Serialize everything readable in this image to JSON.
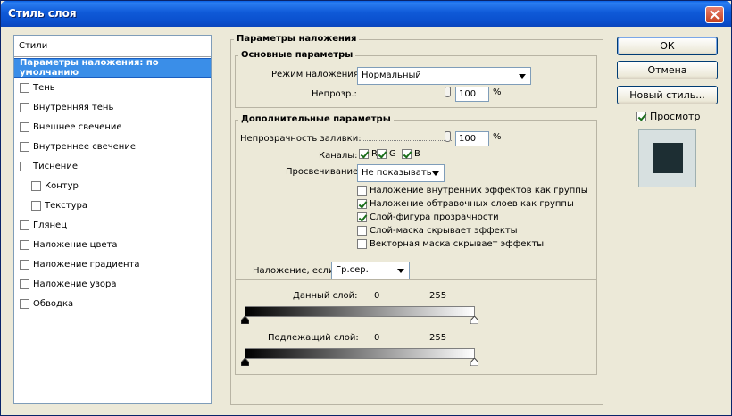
{
  "window": {
    "title": "Стиль слоя"
  },
  "style_list": {
    "header": "Стили",
    "items": [
      {
        "label": "Параметры наложения: по умолчанию",
        "checkbox": false,
        "checked": false,
        "selected": true,
        "indent": false
      },
      {
        "label": "Тень",
        "checkbox": true,
        "checked": false,
        "indent": false
      },
      {
        "label": "Внутренняя тень",
        "checkbox": true,
        "checked": false,
        "indent": false
      },
      {
        "label": "Внешнее свечение",
        "checkbox": true,
        "checked": false,
        "indent": false
      },
      {
        "label": "Внутреннее свечение",
        "checkbox": true,
        "checked": false,
        "indent": false
      },
      {
        "label": "Тиснение",
        "checkbox": true,
        "checked": false,
        "indent": false
      },
      {
        "label": "Контур",
        "checkbox": true,
        "checked": false,
        "indent": true
      },
      {
        "label": "Текстура",
        "checkbox": true,
        "checked": false,
        "indent": true
      },
      {
        "label": "Глянец",
        "checkbox": true,
        "checked": false,
        "indent": false
      },
      {
        "label": "Наложение цвета",
        "checkbox": true,
        "checked": false,
        "indent": false
      },
      {
        "label": "Наложение градиента",
        "checkbox": true,
        "checked": false,
        "indent": false
      },
      {
        "label": "Наложение узора",
        "checkbox": true,
        "checked": false,
        "indent": false
      },
      {
        "label": "Обводка",
        "checkbox": true,
        "checked": false,
        "indent": false
      }
    ]
  },
  "blending": {
    "title": "Параметры наложения",
    "basic": {
      "title": "Основные параметры",
      "mode_label": "Режим наложения:",
      "mode_value": "Нормальный",
      "opacity_label": "Непрозр.:",
      "opacity_value": "100",
      "opacity_unit": "%",
      "opacity_level": 1.0
    },
    "advanced": {
      "title": "Дополнительные параметры",
      "fill_label": "Непрозрачность заливки:",
      "fill_value": "100",
      "fill_unit": "%",
      "fill_level": 1.0,
      "channels_label": "Каналы:",
      "channels": [
        {
          "label": "R",
          "checked": true
        },
        {
          "label": "G",
          "checked": true
        },
        {
          "label": "B",
          "checked": true
        }
      ],
      "knockout_label": "Просвечивание:",
      "knockout_value": "Не показывать",
      "options": [
        {
          "label": "Наложение внутренних эффектов как группы",
          "checked": false
        },
        {
          "label": "Наложение обтравочных слоев как группы",
          "checked": true
        },
        {
          "label": "Слой-фигура прозрачности",
          "checked": true
        },
        {
          "label": "Слой-маска скрывает эффекты",
          "checked": false
        },
        {
          "label": "Векторная маска скрывает эффекты",
          "checked": false
        }
      ]
    },
    "blend_if": {
      "label": "Наложение, если:",
      "value": "Гр.сер.",
      "this_layer_label": "Данный слой:",
      "this_layer_min": "0",
      "this_layer_max": "255",
      "underlying_label": "Подлежащий слой:",
      "underlying_min": "0",
      "underlying_max": "255"
    }
  },
  "buttons": {
    "ok": "ОК",
    "cancel": "Отмена",
    "new_style": "Новый стиль..."
  },
  "preview": {
    "label": "Просмотр",
    "checked": true,
    "swatch_color": "#1d2e33"
  }
}
